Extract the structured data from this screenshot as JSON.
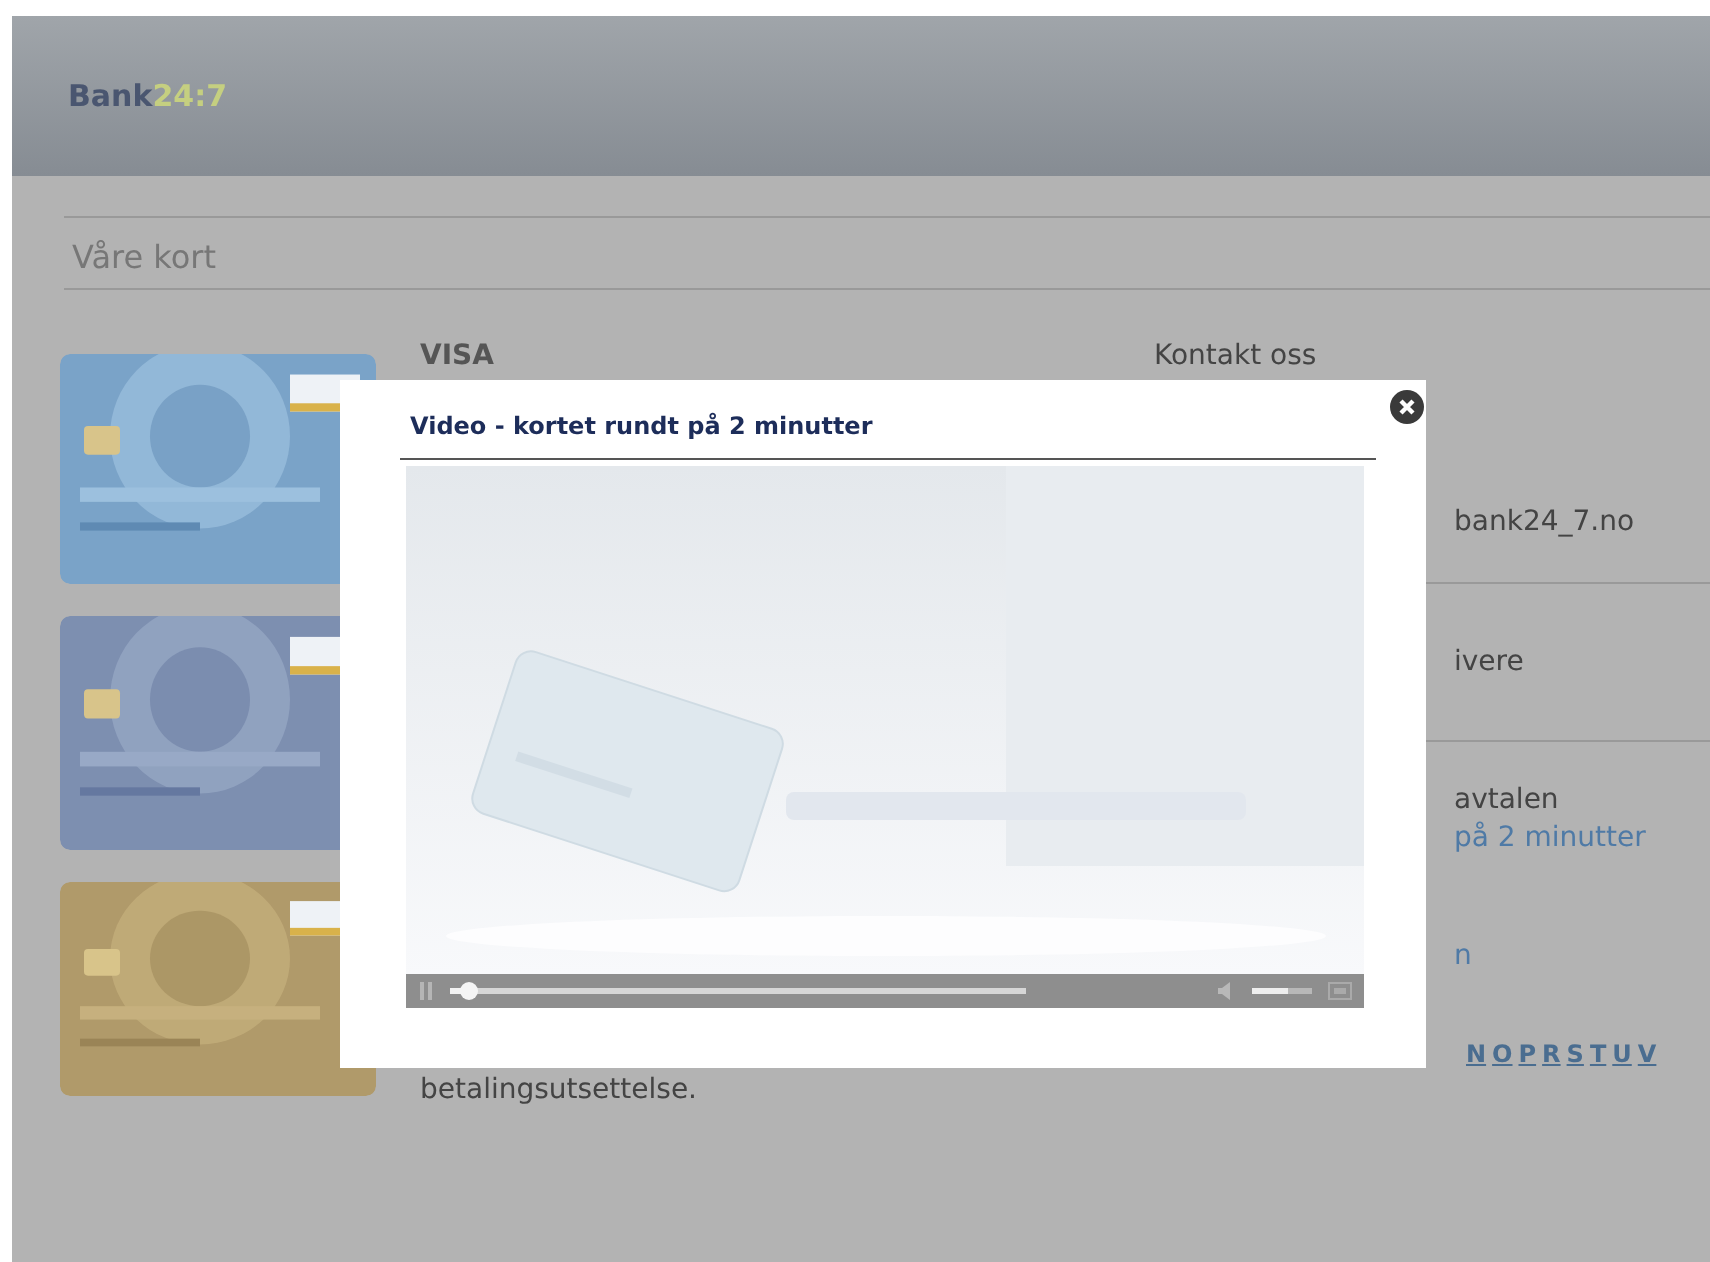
{
  "header": {
    "logo": {
      "name": "Bank",
      "accent": "24:7"
    }
  },
  "page_title": "Våre kort",
  "card_details": {
    "title": "VISA",
    "text_end": "betalingsutsettelse."
  },
  "contact": {
    "title": "Kontakt oss",
    "email_fragment": "bank24_7.no",
    "item_fragment": "ivere",
    "agreement_fragment": "avtalen",
    "video_link": "på 2 minutter",
    "fragment": "n",
    "letters": [
      "N",
      "O",
      "P",
      "R",
      "S",
      "T",
      "U",
      "V"
    ]
  },
  "modal": {
    "title": "Video - kortet rundt på 2 minutter",
    "player": {
      "playing": true,
      "progress": {
        "level": 0.03
      },
      "volume": {
        "level": 0.6
      }
    }
  }
}
